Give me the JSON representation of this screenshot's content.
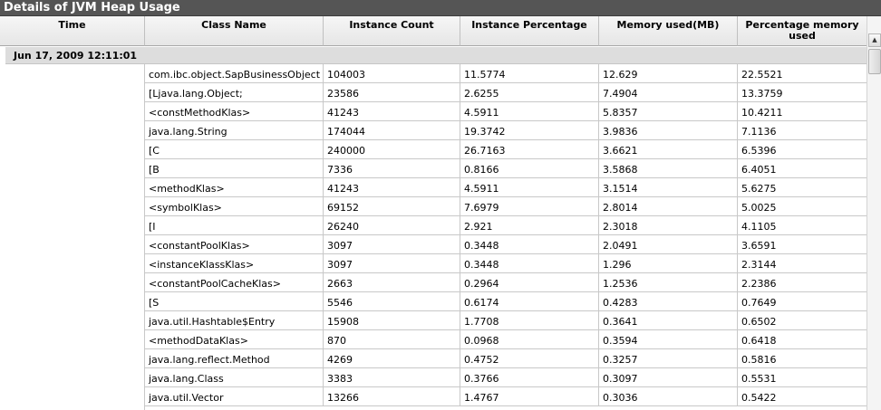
{
  "window": {
    "title": "Details of JVM Heap Usage"
  },
  "columns": [
    "Time",
    "Class Name",
    "Instance Count",
    "Instance Percentage",
    "Memory used(MB)",
    "Percentage memory used"
  ],
  "group": {
    "time": "Jun 17, 2009 12:11:01"
  },
  "rows": [
    {
      "class_name": "com.ibc.object.SapBusinessObject",
      "instance_count": "104003",
      "instance_percentage": "11.5774",
      "memory_used": "12.629",
      "memory_percentage": "22.5521"
    },
    {
      "class_name": "[Ljava.lang.Object;",
      "instance_count": "23586",
      "instance_percentage": "2.6255",
      "memory_used": "7.4904",
      "memory_percentage": "13.3759"
    },
    {
      "class_name": "<constMethodKlas>",
      "instance_count": "41243",
      "instance_percentage": "4.5911",
      "memory_used": "5.8357",
      "memory_percentage": "10.4211"
    },
    {
      "class_name": "java.lang.String",
      "instance_count": "174044",
      "instance_percentage": "19.3742",
      "memory_used": "3.9836",
      "memory_percentage": "7.1136"
    },
    {
      "class_name": "[C",
      "instance_count": "240000",
      "instance_percentage": "26.7163",
      "memory_used": "3.6621",
      "memory_percentage": "6.5396"
    },
    {
      "class_name": "[B",
      "instance_count": "7336",
      "instance_percentage": "0.8166",
      "memory_used": "3.5868",
      "memory_percentage": "6.4051"
    },
    {
      "class_name": "<methodKlas>",
      "instance_count": "41243",
      "instance_percentage": "4.5911",
      "memory_used": "3.1514",
      "memory_percentage": "5.6275"
    },
    {
      "class_name": "<symbolKlas>",
      "instance_count": "69152",
      "instance_percentage": "7.6979",
      "memory_used": "2.8014",
      "memory_percentage": "5.0025"
    },
    {
      "class_name": "[I",
      "instance_count": "26240",
      "instance_percentage": "2.921",
      "memory_used": "2.3018",
      "memory_percentage": "4.1105"
    },
    {
      "class_name": "<constantPoolKlas>",
      "instance_count": "3097",
      "instance_percentage": "0.3448",
      "memory_used": "2.0491",
      "memory_percentage": "3.6591"
    },
    {
      "class_name": "<instanceKlassKlas>",
      "instance_count": "3097",
      "instance_percentage": "0.3448",
      "memory_used": "1.296",
      "memory_percentage": "2.3144"
    },
    {
      "class_name": "<constantPoolCacheKlas>",
      "instance_count": "2663",
      "instance_percentage": "0.2964",
      "memory_used": "1.2536",
      "memory_percentage": "2.2386"
    },
    {
      "class_name": "[S",
      "instance_count": "5546",
      "instance_percentage": "0.6174",
      "memory_used": "0.4283",
      "memory_percentage": "0.7649"
    },
    {
      "class_name": "java.util.Hashtable$Entry",
      "instance_count": "15908",
      "instance_percentage": "1.7708",
      "memory_used": "0.3641",
      "memory_percentage": "0.6502"
    },
    {
      "class_name": "<methodDataKlas>",
      "instance_count": "870",
      "instance_percentage": "0.0968",
      "memory_used": "0.3594",
      "memory_percentage": "0.6418"
    },
    {
      "class_name": "java.lang.reflect.Method",
      "instance_count": "4269",
      "instance_percentage": "0.4752",
      "memory_used": "0.3257",
      "memory_percentage": "0.5816"
    },
    {
      "class_name": "java.lang.Class",
      "instance_count": "3383",
      "instance_percentage": "0.3766",
      "memory_used": "0.3097",
      "memory_percentage": "0.5531"
    },
    {
      "class_name": "java.util.Vector",
      "instance_count": "13266",
      "instance_percentage": "1.4767",
      "memory_used": "0.3036",
      "memory_percentage": "0.5422"
    }
  ],
  "scrollbar": {
    "up_icon": "arrow-up-icon"
  }
}
